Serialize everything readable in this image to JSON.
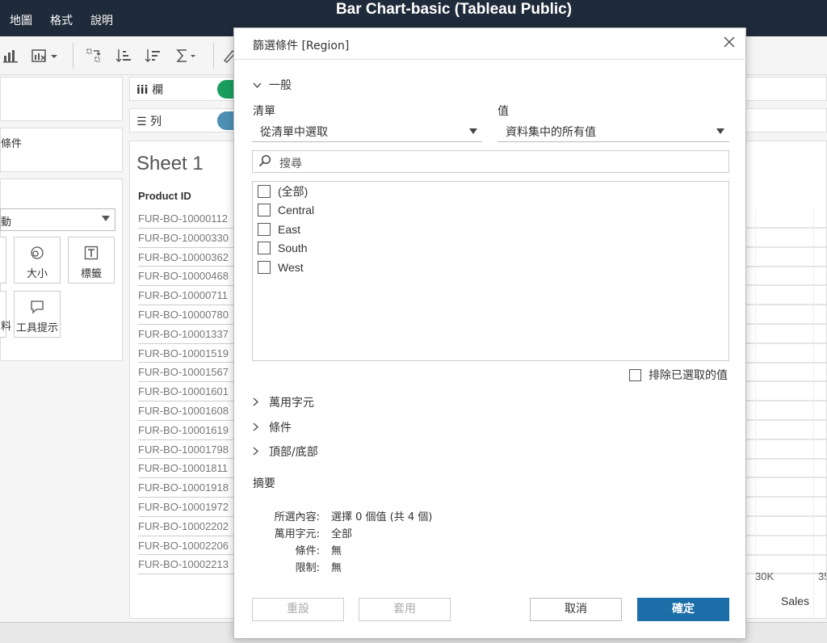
{
  "app": {
    "title": "Bar Chart-basic (Tableau Public)",
    "menu": [
      "地圖",
      "格式",
      "說明"
    ]
  },
  "left_panel": {
    "filters_label": "條件",
    "mark_type": "動",
    "mark_buttons": {
      "size": "大小",
      "label": "標籤",
      "detail": "料",
      "tooltip": "工具提示"
    }
  },
  "shelves": {
    "columns_label": "欄",
    "rows_label": "列",
    "columns_pill_color": "#1a9e5f",
    "rows_pill_color": "#4e8fb5"
  },
  "sheet": {
    "title": "Sheet 1",
    "column_header": "Product ID",
    "rows": [
      "FUR-BO-10000112",
      "FUR-BO-10000330",
      "FUR-BO-10000362",
      "FUR-BO-10000468",
      "FUR-BO-10000711",
      "FUR-BO-10000780",
      "FUR-BO-10001337",
      "FUR-BO-10001519",
      "FUR-BO-10001567",
      "FUR-BO-10001601",
      "FUR-BO-10001608",
      "FUR-BO-10001619",
      "FUR-BO-10001798",
      "FUR-BO-10001811",
      "FUR-BO-10001918",
      "FUR-BO-10001972",
      "FUR-BO-10002202",
      "FUR-BO-10002206",
      "FUR-BO-10002213"
    ],
    "axis_ticks": [
      "30K",
      "35"
    ],
    "axis_label": "Sales"
  },
  "dialog": {
    "title": "篩選條件 [Region]",
    "sections": {
      "general": "一般",
      "wildcard": "萬用字元",
      "condition": "條件",
      "top_bottom": "頂部/底部"
    },
    "list_label": "清單",
    "list_mode": "從清單中選取",
    "values_label": "值",
    "values_mode": "資料集中的所有值",
    "search_placeholder": "搜尋",
    "items": [
      "(全部)",
      "Central",
      "East",
      "South",
      "West"
    ],
    "exclude_label": "排除已選取的值",
    "summary": {
      "title": "摘要",
      "selected_key": "所選內容:",
      "selected_val": "選擇 0 個值 (共 4 個)",
      "wildcard_key": "萬用字元:",
      "wildcard_val": "全部",
      "condition_key": "條件:",
      "condition_val": "無",
      "limit_key": "限制:",
      "limit_val": "無"
    },
    "buttons": {
      "reset": "重設",
      "apply": "套用",
      "cancel": "取消",
      "ok": "確定"
    },
    "primary_color": "#1b6ea8"
  }
}
